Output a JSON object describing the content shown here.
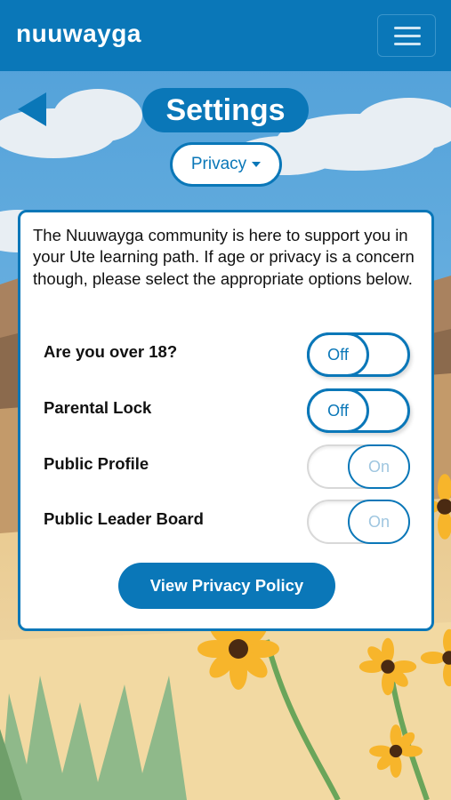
{
  "app": {
    "brand": "nuuwayga"
  },
  "header": {
    "menu_icon": "hamburger-menu-icon",
    "back_icon": "back-arrow-icon"
  },
  "page": {
    "title": "Settings",
    "section_dropdown": {
      "selected": "Privacy",
      "icon": "caret-down-icon"
    }
  },
  "privacy": {
    "intro": "The Nuuwayga community is here to support you in your Ute learning path. If age or privacy is a concern though, please select the appropriate options below.",
    "options": [
      {
        "label": "Are you over 18?",
        "state": "Off"
      },
      {
        "label": "Parental Lock",
        "state": "Off"
      },
      {
        "label": "Public Profile",
        "state": "On"
      },
      {
        "label": "Public Leader Board",
        "state": "On"
      }
    ],
    "policy_button": "View Privacy Policy"
  },
  "colors": {
    "accent": "#0a77b8",
    "card_bg": "#ffffff",
    "off_text": "#0a77b8",
    "on_text": "#9fc6e0"
  }
}
